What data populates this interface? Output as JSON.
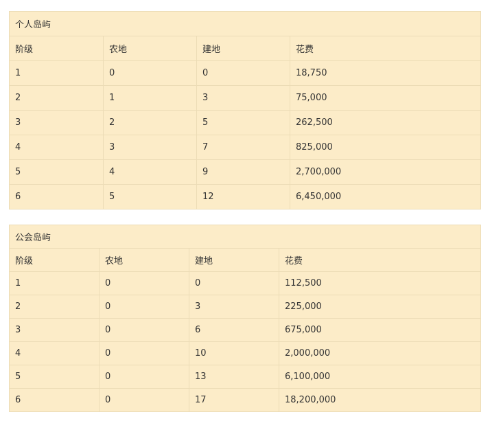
{
  "tables": [
    {
      "title": "个人岛屿",
      "headers": [
        "阶级",
        "农地",
        "建地",
        "花费"
      ],
      "rows": [
        [
          "1",
          "0",
          "0",
          "18,750"
        ],
        [
          "2",
          "1",
          "3",
          "75,000"
        ],
        [
          "3",
          "2",
          "5",
          "262,500"
        ],
        [
          "4",
          "3",
          "7",
          "825,000"
        ],
        [
          "5",
          "4",
          "9",
          "2,700,000"
        ],
        [
          "6",
          "5",
          "12",
          "6,450,000"
        ]
      ]
    },
    {
      "title": "公会岛屿",
      "headers": [
        "阶级",
        "农地",
        "建地",
        "花费"
      ],
      "rows": [
        [
          "1",
          "0",
          "0",
          "112,500"
        ],
        [
          "2",
          "0",
          "3",
          "225,000"
        ],
        [
          "3",
          "0",
          "6",
          "675,000"
        ],
        [
          "4",
          "0",
          "10",
          "2,000,000"
        ],
        [
          "5",
          "0",
          "13",
          "6,100,000"
        ],
        [
          "6",
          "0",
          "17",
          "18,200,000"
        ]
      ]
    }
  ]
}
